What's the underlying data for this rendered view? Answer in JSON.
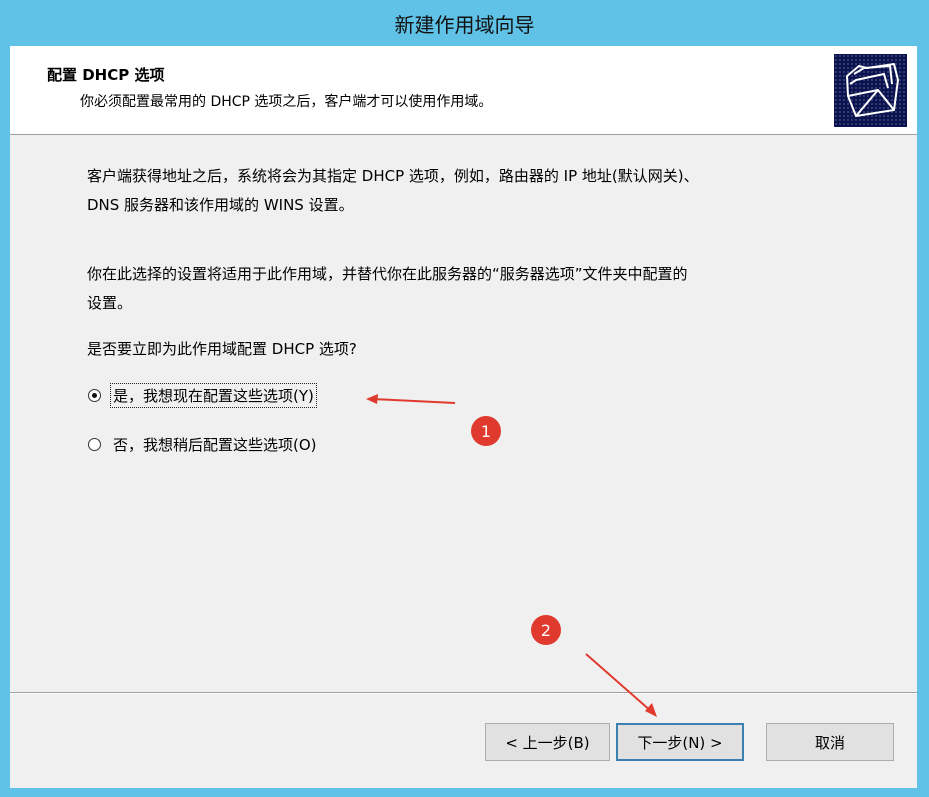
{
  "window": {
    "title": "新建作用域向导"
  },
  "header": {
    "title": "配置 DHCP 选项",
    "subtitle": "你必须配置最常用的 DHCP 选项之后，客户端才可以使用作用域。"
  },
  "body": {
    "para1_line1": "客户端获得地址之后，系统将会为其指定 DHCP 选项，例如，路由器的 IP 地址(默认网关)、",
    "para1_line2": "DNS 服务器和该作用域的 WINS 设置。",
    "para2_line1": "你在此选择的设置将适用于此作用域，并替代你在此服务器的“服务器选项”文件夹中配置的",
    "para2_line2": "设置。",
    "question": "是否要立即为此作用域配置 DHCP 选项?"
  },
  "options": {
    "yes_label": "是，我想现在配置这些选项(Y)",
    "no_label": "否，我想稍后配置这些选项(O)",
    "selected": "yes"
  },
  "buttons": {
    "back": "< 上一步(B)",
    "next": "下一步(N) >",
    "cancel": "取消"
  },
  "annotations": {
    "marker1": "1",
    "marker2": "2",
    "color": "#e03a2f"
  }
}
